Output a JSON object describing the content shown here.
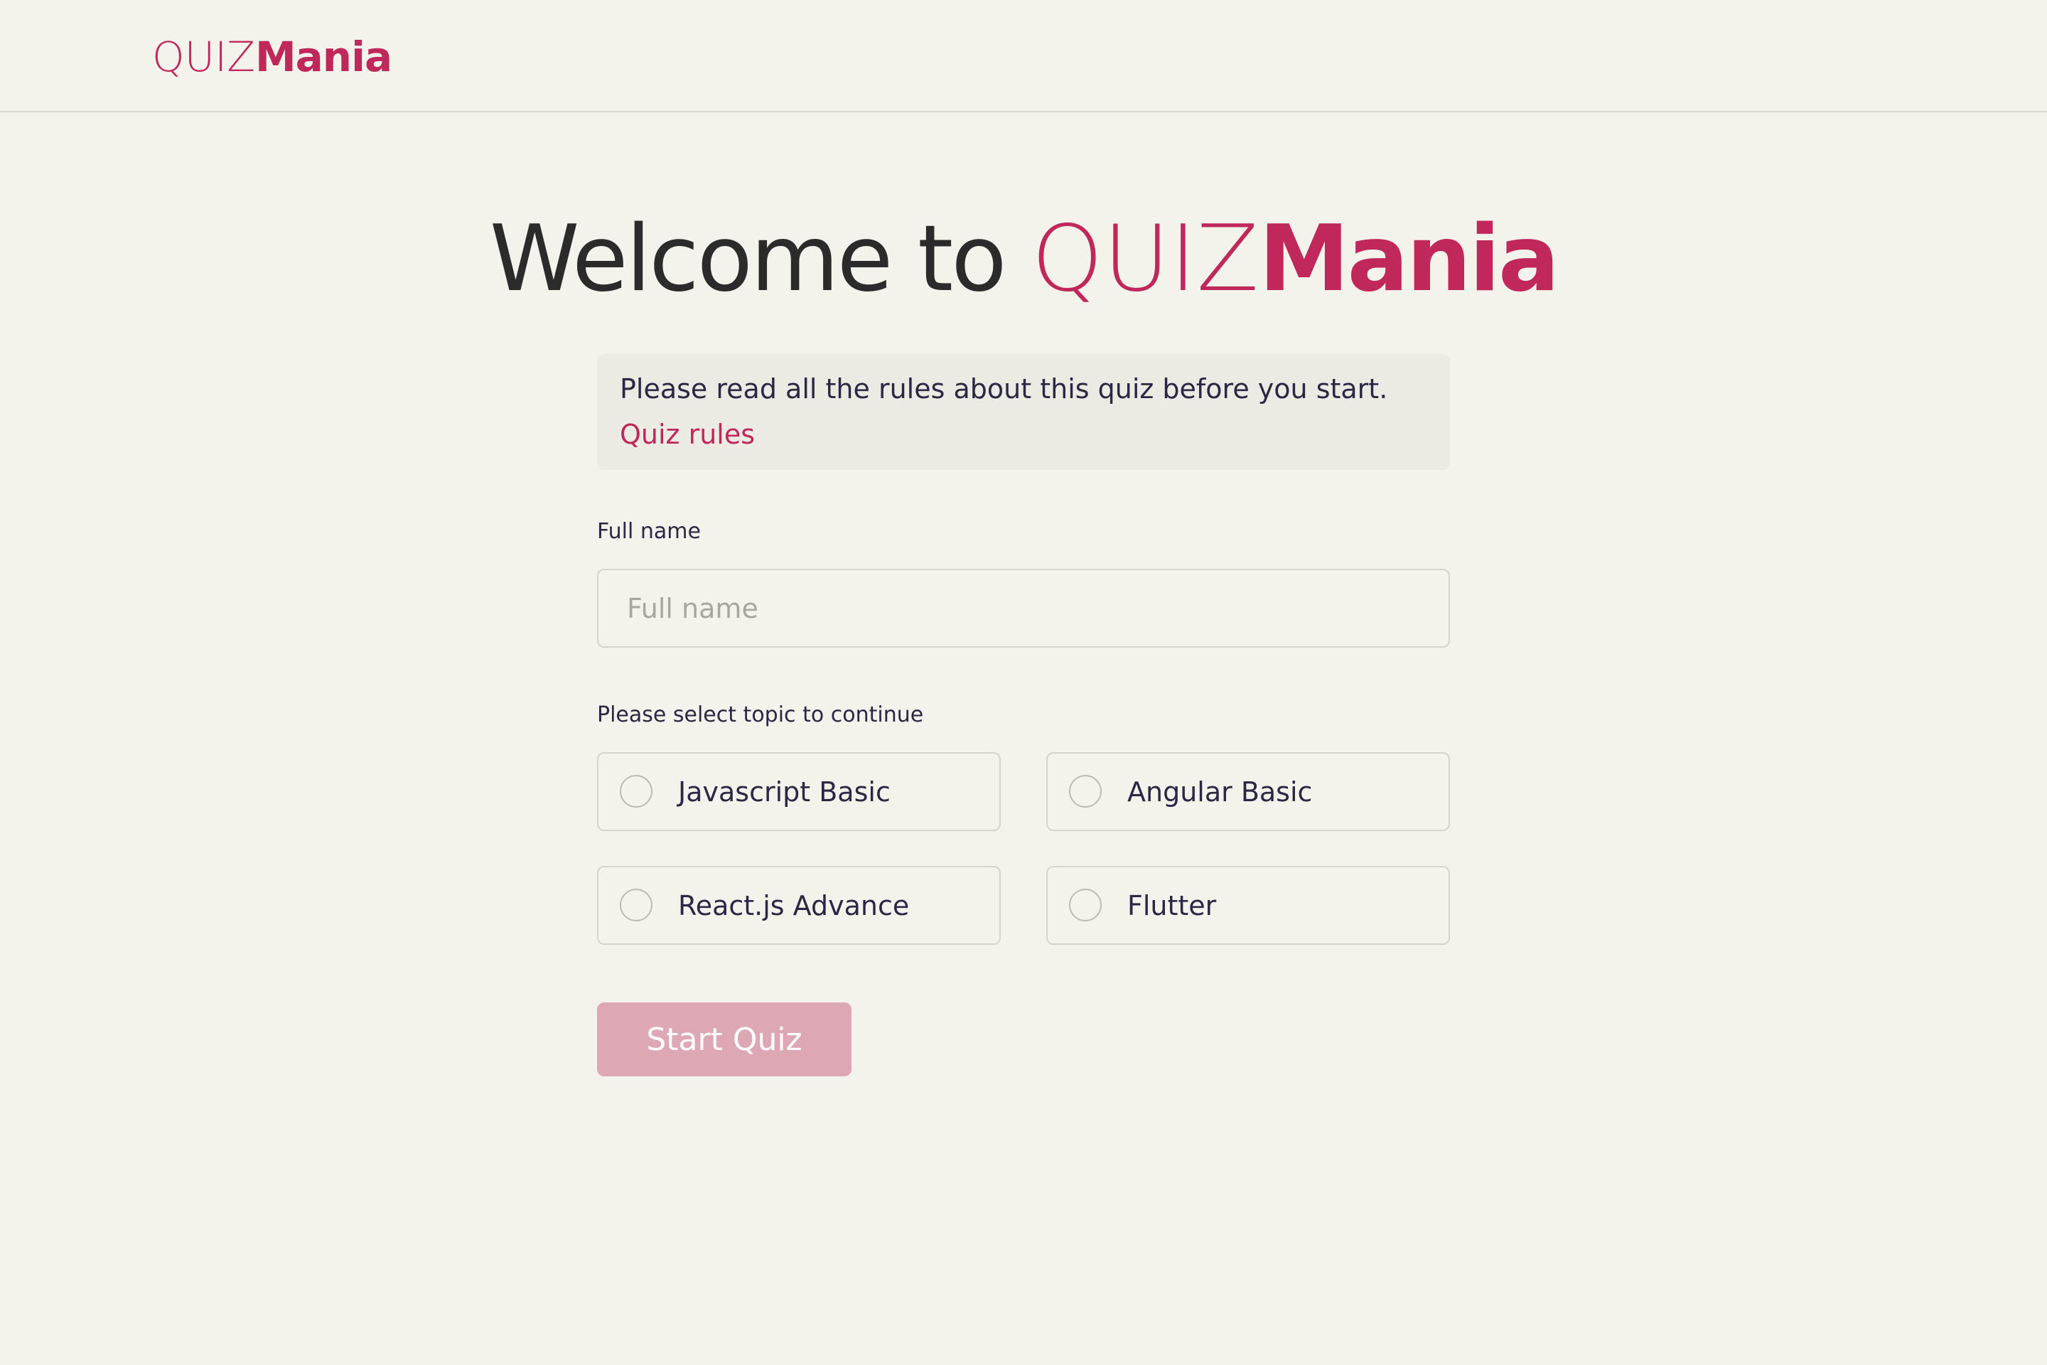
{
  "header": {
    "logo_light": "QUIZ",
    "logo_bold": "Mania"
  },
  "welcome": {
    "prefix": "Welcome to ",
    "brand_light": "QUIZ",
    "brand_bold": "Mania"
  },
  "info": {
    "text": "Please read all the rules about this quiz before you start.",
    "link_label": "Quiz rules"
  },
  "form": {
    "name_label": "Full name",
    "name_placeholder": "Full name",
    "name_value": "",
    "topic_label": "Please select topic to continue",
    "topics": [
      {
        "label": "Javascript Basic",
        "selected": false
      },
      {
        "label": "Angular Basic",
        "selected": false
      },
      {
        "label": "React.js Advance",
        "selected": false
      },
      {
        "label": "Flutter",
        "selected": false
      }
    ],
    "start_label": "Start Quiz"
  },
  "colors": {
    "brand": "#c0275b",
    "background": "#f4f3eb",
    "button_disabled": "#dea7b4"
  }
}
